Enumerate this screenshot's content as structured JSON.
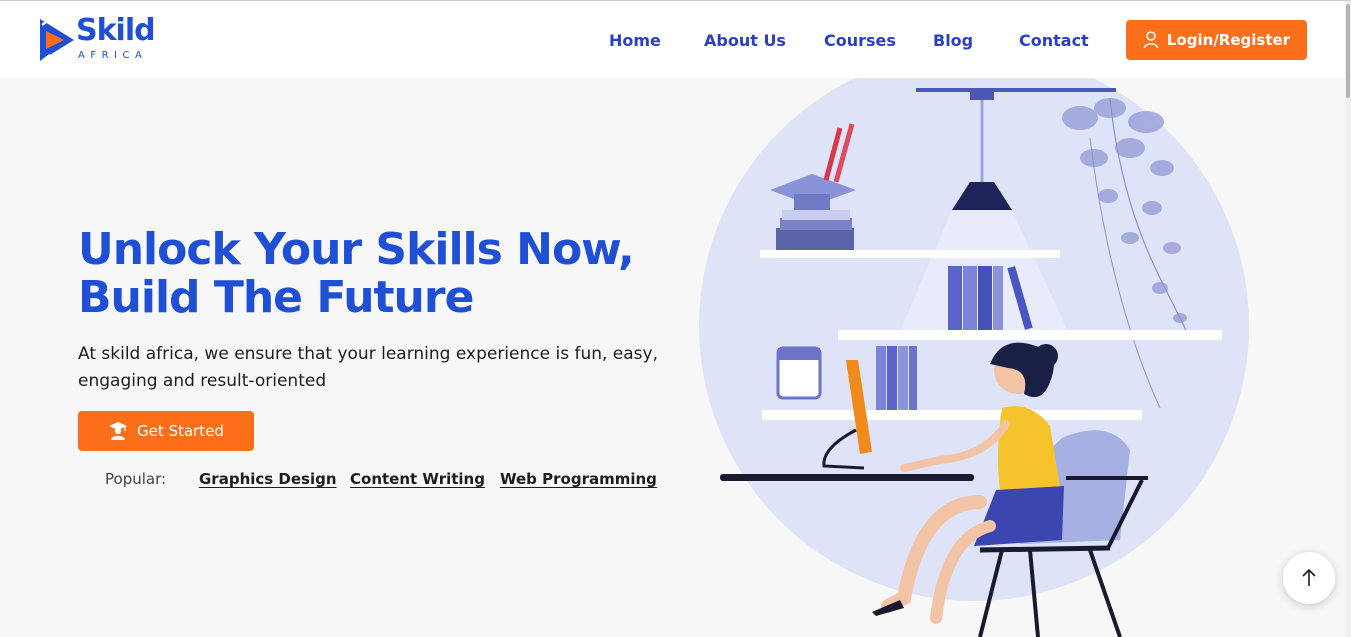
{
  "brand": {
    "name": "Skild",
    "tagline": "AFRICA",
    "primary_color": "#1e4fd4",
    "accent_color": "#fb6f1b"
  },
  "nav": {
    "items": [
      "Home",
      "About Us",
      "Courses",
      "Blog",
      "Contact"
    ],
    "login_label": "Login/Register",
    "login_icon": "user-icon"
  },
  "hero": {
    "title_line1": "Unlock Your Skills Now,",
    "title_line2": "Build The Future",
    "subtitle": "At skild africa, we ensure that your learning experience is fun, easy, engaging and result-oriented",
    "cta_label": "Get Started",
    "cta_icon": "graduate-icon"
  },
  "popular": {
    "label": "Popular:",
    "links": [
      "Graphics Design",
      "Content Writing",
      "Web Programming"
    ]
  },
  "scroll_top_icon": "arrow-up-icon"
}
